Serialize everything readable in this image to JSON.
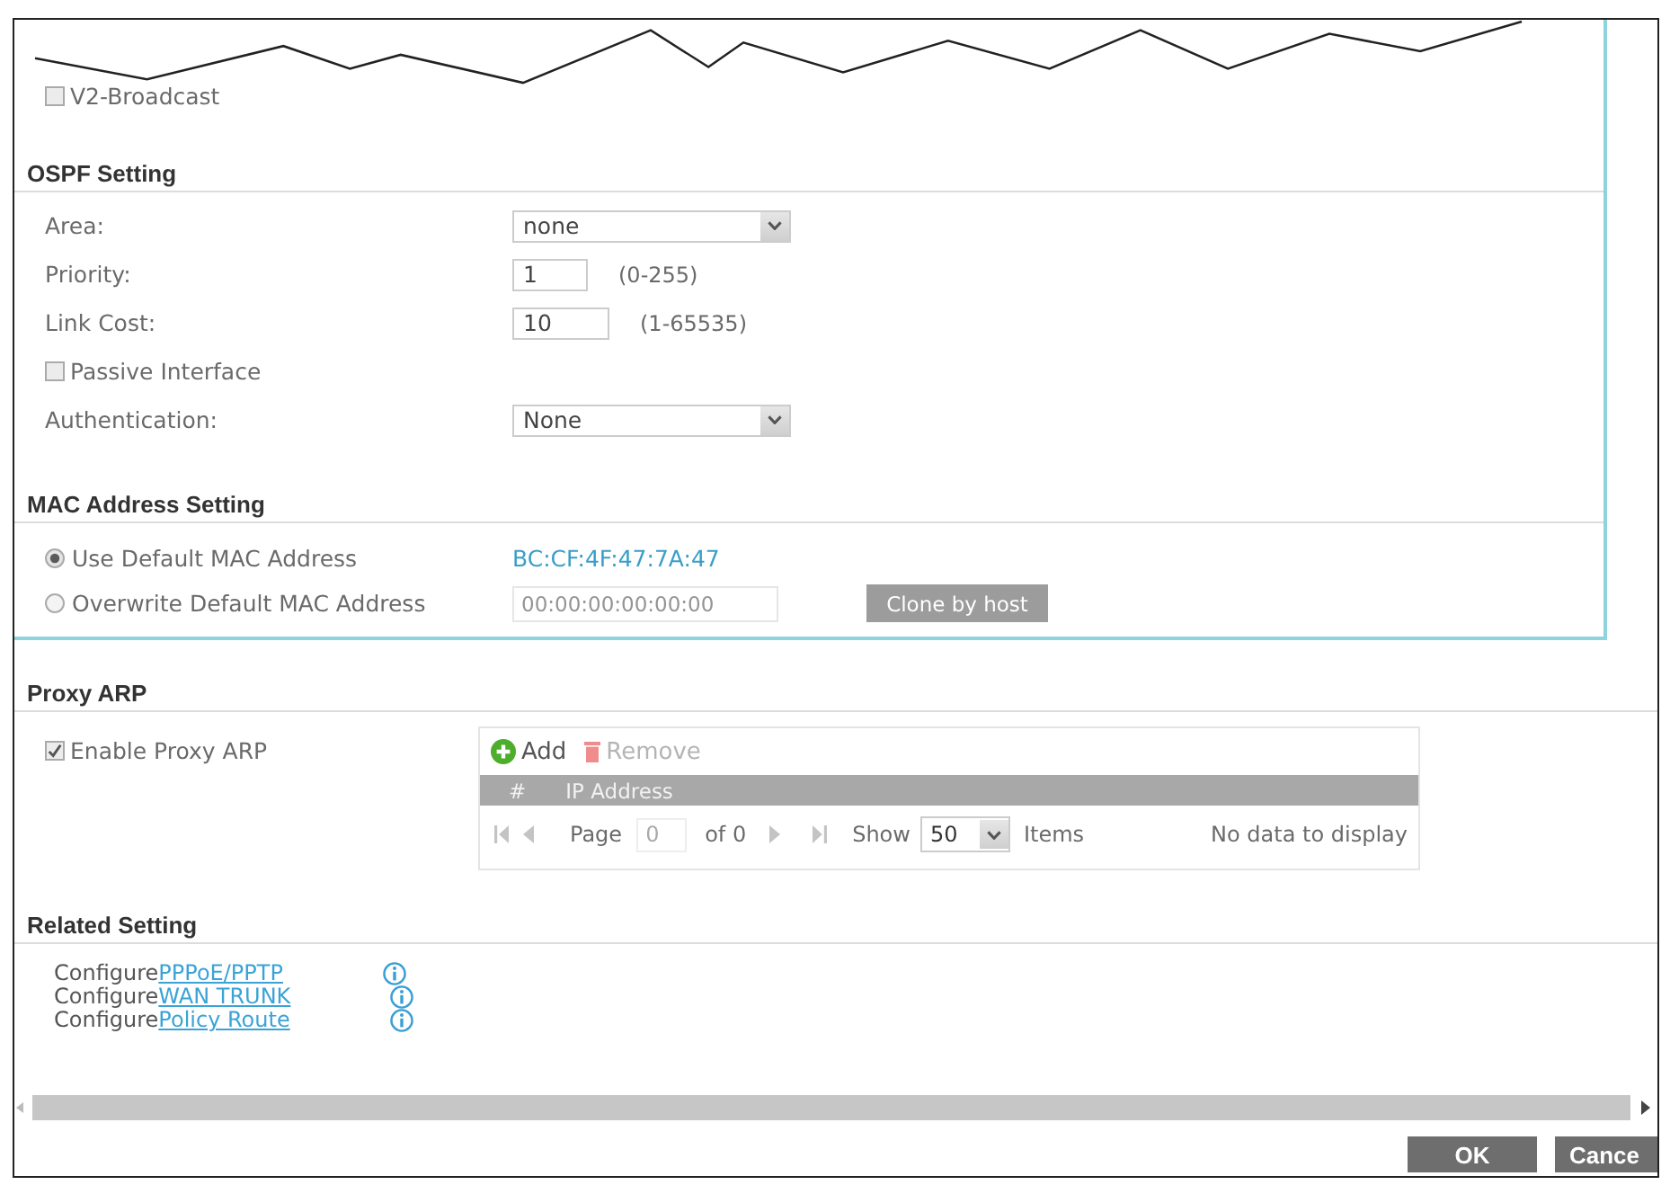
{
  "v2_broadcast": {
    "label": "V2-Broadcast",
    "checked": false
  },
  "ospf_setting": {
    "title": "OSPF Setting",
    "fields": [
      {
        "kind": "select",
        "label": "Area:",
        "value": "none"
      },
      {
        "kind": "number",
        "label": "Priority:",
        "value": "1",
        "range": "(0-255)"
      },
      {
        "kind": "number",
        "label": "Link Cost:",
        "value": "10",
        "range": "(1-65535)"
      },
      {
        "kind": "checkbox",
        "label": "Passive Interface",
        "checked": false
      },
      {
        "kind": "select",
        "label": "Authentication:",
        "value": "None"
      }
    ]
  },
  "mac_address_setting": {
    "title": "MAC Address Setting",
    "options": [
      {
        "label": "Use Default MAC Address",
        "selected": true,
        "value": "BC:CF:4F:47:7A:47"
      },
      {
        "label": "Overwrite Default MAC Address",
        "selected": false,
        "field": {
          "value": "00:00:00:00:00:00",
          "disabled": true
        },
        "button": {
          "label": "Clone by host",
          "disabled": true
        }
      }
    ]
  },
  "proxy_arp": {
    "title": "Proxy ARP",
    "enable": {
      "label": "Enable Proxy ARP",
      "checked": true
    },
    "table": {
      "toolbar": [
        {
          "kind": "add",
          "label": "Add",
          "disabled": false
        },
        {
          "kind": "remove",
          "label": "Remove",
          "disabled": true
        }
      ],
      "columns": [
        "#",
        "IP Address"
      ],
      "pager": {
        "page_label": "Page",
        "page": "0",
        "of": "of 0",
        "show_label": "Show",
        "page_size": "50",
        "items_label": "Items",
        "status": "No data to display"
      }
    }
  },
  "related_setting": {
    "title": "Related Setting",
    "links": [
      {
        "prefix": "Configure",
        "link": "PPPoE/PPTP"
      },
      {
        "prefix": "Configure",
        "link": "WAN TRUNK"
      },
      {
        "prefix": "Configure",
        "link": "Policy Route"
      }
    ]
  },
  "buttons": [
    {
      "label": "OK"
    },
    {
      "label": "Cance"
    }
  ]
}
